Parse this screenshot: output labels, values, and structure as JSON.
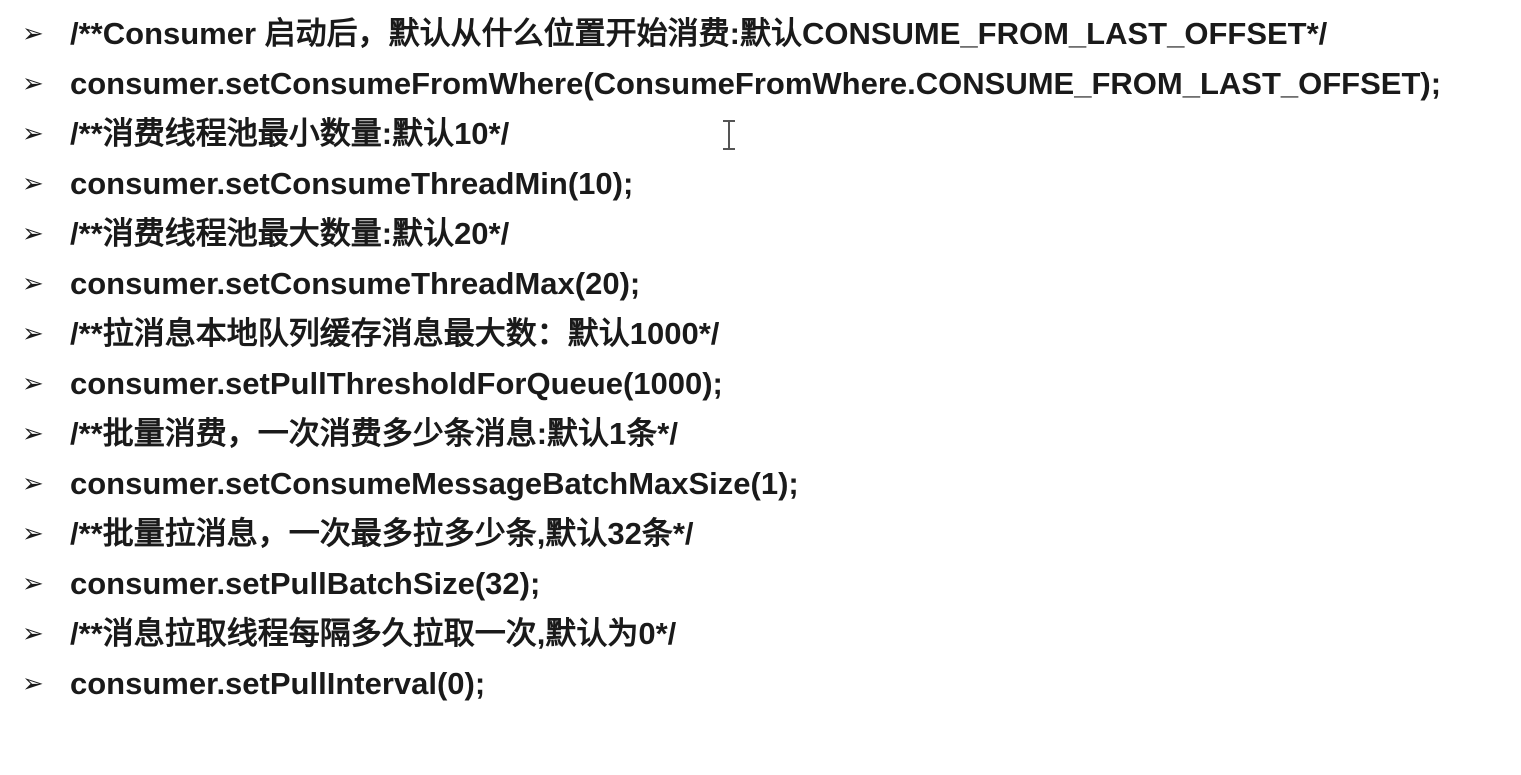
{
  "slide": {
    "bullet_marker": "➢",
    "items": [
      "/**Consumer 启动后，默认从什么位置开始消费:默认CONSUME_FROM_LAST_OFFSET*/",
      "consumer.setConsumeFromWhere(ConsumeFromWhere.CONSUME_FROM_LAST_OFFSET);",
      "/**消费线程池最小数量:默认10*/",
      "consumer.setConsumeThreadMin(10);",
      "/**消费线程池最大数量:默认20*/",
      "consumer.setConsumeThreadMax(20);",
      "/**拉消息本地队列缓存消息最大数：默认1000*/",
      "consumer.setPullThresholdForQueue(1000);",
      "/**批量消费，一次消费多少条消息:默认1条*/",
      "consumer.setConsumeMessageBatchMaxSize(1);",
      "/**批量拉消息，一次最多拉多少条,默认32条*/",
      "consumer.setPullBatchSize(32);",
      "/**消息拉取线程每隔多久拉取一次,默认为0*/",
      "consumer.setPullInterval(0);"
    ]
  }
}
